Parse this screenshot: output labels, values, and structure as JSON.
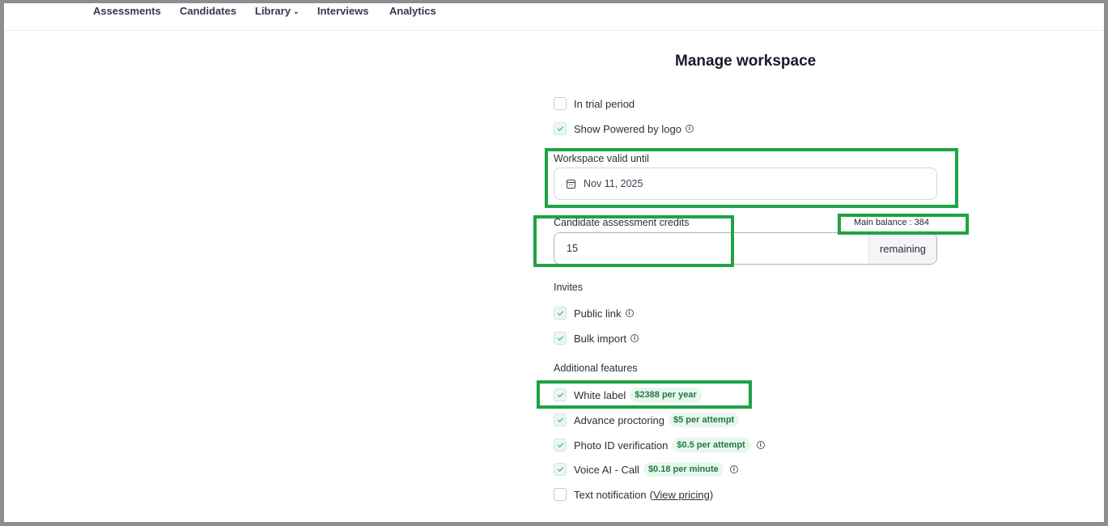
{
  "nav": {
    "items": [
      {
        "label": "Assessments"
      },
      {
        "label": "Candidates"
      },
      {
        "label": "Library"
      },
      {
        "label": "Interviews"
      },
      {
        "label": "Analytics"
      }
    ]
  },
  "page": {
    "title": "Manage workspace"
  },
  "settings": {
    "trial": {
      "label": "In trial period",
      "checked": false
    },
    "powered_by": {
      "label": "Show Powered by logo",
      "checked": true,
      "icon": "info-icon"
    }
  },
  "workspace_valid": {
    "label": "Workspace valid until",
    "value": "Nov 11, 2025",
    "icon": "calendar-icon"
  },
  "credits": {
    "label": "Candidate assessment credits",
    "value": "15",
    "suffix": "remaining",
    "main_balance": "Main balance : 384"
  },
  "invites": {
    "heading": "Invites",
    "items": [
      {
        "label": "Public link",
        "checked": true
      },
      {
        "label": "Bulk import",
        "checked": true
      }
    ]
  },
  "additional": {
    "heading": "Additional features",
    "items": [
      {
        "label": "White label",
        "price": "$2388 per year",
        "checked": true
      },
      {
        "label": "Advance proctoring",
        "price": "$5 per attempt",
        "checked": true
      },
      {
        "label": "Photo ID verification",
        "price": "$0.5 per attempt",
        "checked": true,
        "info": true
      },
      {
        "label": "Voice AI - Call",
        "price": "$0.18 per minute",
        "checked": true,
        "info": true
      }
    ],
    "text_notification": {
      "label": "Text notification",
      "open": "(",
      "link": "View pricing",
      "close": ")",
      "checked": false
    }
  },
  "colors": {
    "highlight": "#1ea345",
    "badge_bg": "#e8f6ed",
    "badge_text": "#1f7a44"
  }
}
